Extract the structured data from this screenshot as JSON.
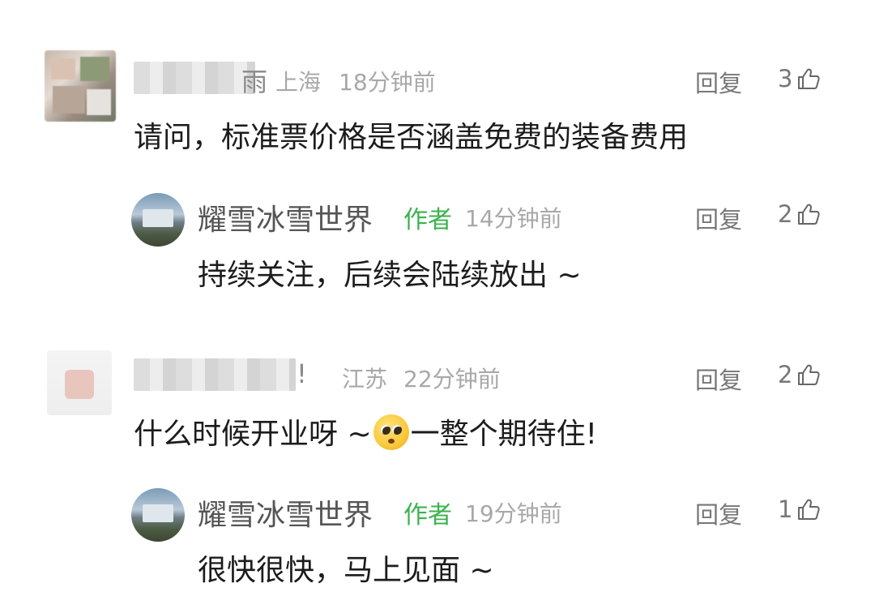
{
  "comments": [
    {
      "author_suffix": "雨",
      "location": "上海",
      "time": "18分钟前",
      "reply_label": "回复",
      "likes": "3",
      "content": "请问，标准票价格是否涵盖免费的装备费用",
      "reply": {
        "author": "耀雪冰雪世界",
        "author_tag": "作者",
        "time": "14分钟前",
        "reply_label": "回复",
        "likes": "2",
        "content": "持续关注，后续会陆续放出 ~"
      }
    },
    {
      "author_suffix": "!",
      "location": "江苏",
      "time": "22分钟前",
      "reply_label": "回复",
      "likes": "2",
      "content_before_emoji": "什么时候开业呀 ~",
      "emoji": "pleading-face-emoji",
      "content_after_emoji": "一整个期待住!",
      "reply": {
        "author": "耀雪冰雪世界",
        "author_tag": "作者",
        "time": "19分钟前",
        "reply_label": "回复",
        "likes": "1",
        "content": "很快很快，马上见面 ~"
      }
    }
  ],
  "icons": {
    "like": "thumbs-up-icon"
  },
  "colors": {
    "author_tag": "#3bb24e",
    "meta": "#a8a8a8",
    "content": "#1c1c1c",
    "name": "#555555"
  }
}
